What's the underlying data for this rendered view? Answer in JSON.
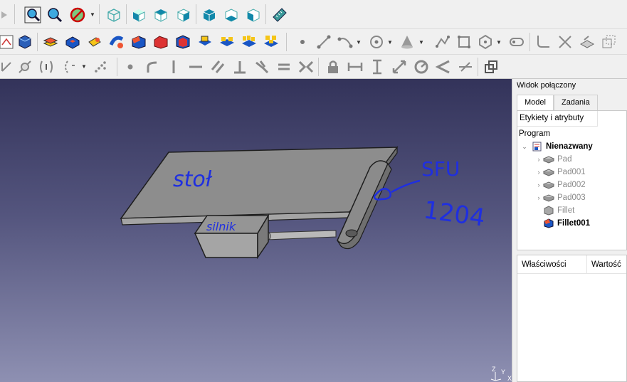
{
  "combo_view": {
    "title": "Widok połączony",
    "tabs": [
      {
        "label": "Model",
        "active": true
      },
      {
        "label": "Zadania",
        "active": false
      }
    ]
  },
  "tree": {
    "header": "Etykiety i atrybuty",
    "root_label": "Program",
    "document": "Nienazwany",
    "items": [
      {
        "label": "Pad",
        "state": "hidden"
      },
      {
        "label": "Pad001",
        "state": "hidden"
      },
      {
        "label": "Pad002",
        "state": "hidden"
      },
      {
        "label": "Pad003",
        "state": "hidden"
      },
      {
        "label": "Fillet",
        "state": "hidden"
      },
      {
        "label": "Fillet001",
        "state": "visible"
      }
    ]
  },
  "properties": {
    "col_property": "Właściwości",
    "col_value": "Wartość"
  },
  "annotations": {
    "table": "stoł",
    "motor": "silnik",
    "screw_1": "SFU",
    "screw_2": "1204"
  },
  "axis": {
    "z": "Z",
    "y": "Y",
    "x": "X"
  },
  "colors": {
    "view_top": "#33335a",
    "view_bottom": "#8e90b2",
    "handwriting": "#1f2fe0",
    "part_gray": "#8c8c8c"
  }
}
